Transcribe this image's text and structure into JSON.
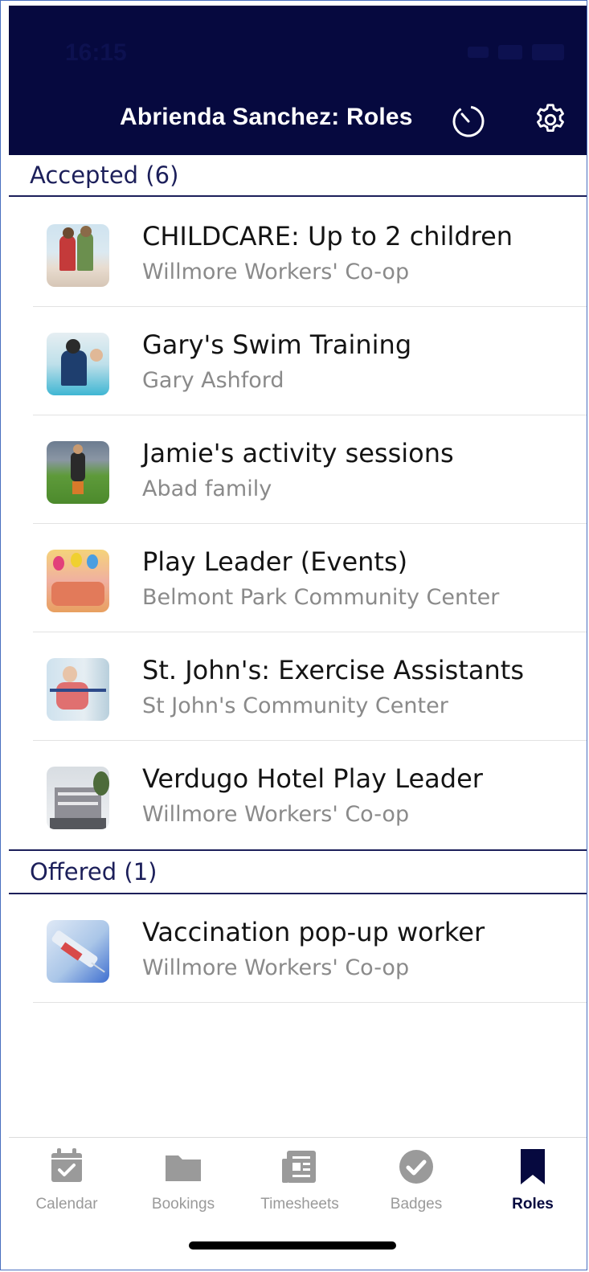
{
  "status_bar": {
    "time": "16:15"
  },
  "header": {
    "title": "Abrienda Sanchez: Roles",
    "timer_icon": "timer-icon",
    "settings_icon": "gear-icon",
    "background": "#06093f"
  },
  "sections": {
    "accepted": {
      "label": "Accepted (6)",
      "items": [
        {
          "title": "CHILDCARE: Up to 2 children",
          "subtitle": "Willmore Workers' Co-op"
        },
        {
          "title": "Gary's Swim Training",
          "subtitle": "Gary Ashford"
        },
        {
          "title": "Jamie's activity sessions",
          "subtitle": "Abad family"
        },
        {
          "title": "Play Leader (Events)",
          "subtitle": "Belmont Park Community Center"
        },
        {
          "title": "St. John's: Exercise Assistants",
          "subtitle": "St John's Community Center"
        },
        {
          "title": "Verdugo Hotel Play Leader",
          "subtitle": "Willmore Workers' Co-op"
        }
      ]
    },
    "offered": {
      "label": "Offered (1)",
      "items": [
        {
          "title": "Vaccination pop-up worker",
          "subtitle": "Willmore Workers' Co-op"
        }
      ]
    }
  },
  "tabbar": {
    "tabs": [
      {
        "label": "Calendar",
        "icon": "calendar-icon"
      },
      {
        "label": "Bookings",
        "icon": "folder-icon"
      },
      {
        "label": "Timesheets",
        "icon": "timesheet-icon"
      },
      {
        "label": "Badges",
        "icon": "badge-check-icon"
      },
      {
        "label": "Roles",
        "icon": "bookmark-icon",
        "active": true
      }
    ],
    "active_color": "#06093f",
    "inactive_color": "#9a9a9a"
  }
}
